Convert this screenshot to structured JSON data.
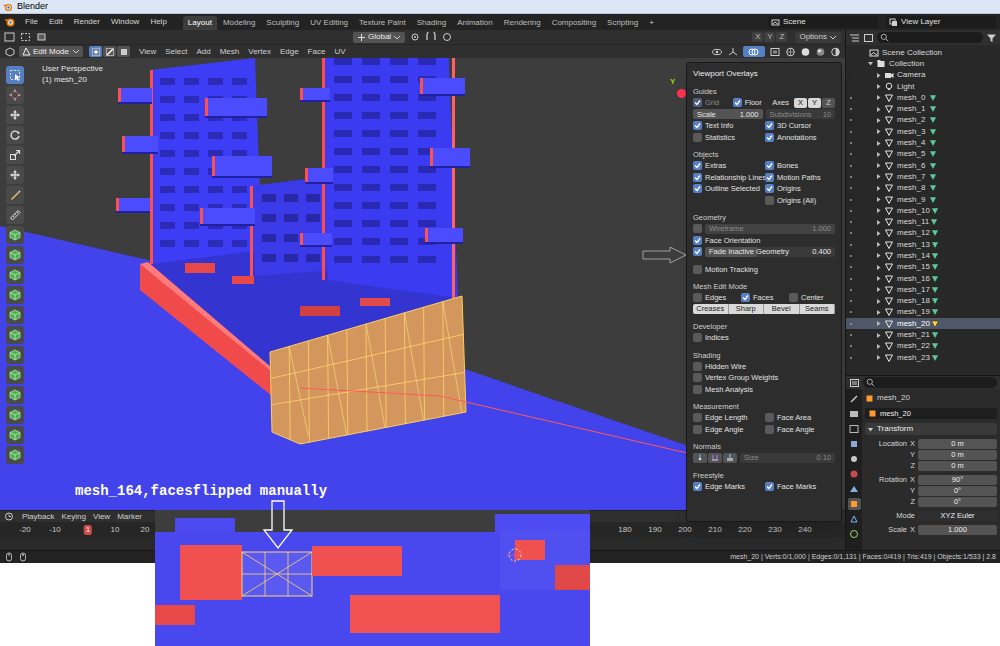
{
  "window": {
    "title": "Blender"
  },
  "topbar": {
    "menus": [
      "File",
      "Edit",
      "Render",
      "Window",
      "Help"
    ],
    "workspaces": [
      {
        "label": "Layout",
        "selected": true
      },
      {
        "label": "Modeling",
        "selected": false
      },
      {
        "label": "Sculpting",
        "selected": false
      },
      {
        "label": "UV Editing",
        "selected": false
      },
      {
        "label": "Texture Paint",
        "selected": false
      },
      {
        "label": "Shading",
        "selected": false
      },
      {
        "label": "Animation",
        "selected": false
      },
      {
        "label": "Rendering",
        "selected": false
      },
      {
        "label": "Compositing",
        "selected": false
      },
      {
        "label": "Scripting",
        "selected": false
      }
    ],
    "add_workspace": "+",
    "scene": "Scene",
    "view_layer": "View Layer"
  },
  "tool_settings": {
    "orientation": "Global",
    "mirror": [
      {
        "label": "X",
        "on": false
      },
      {
        "label": "Y",
        "on": false
      },
      {
        "label": "Z",
        "on": false
      }
    ],
    "options": "Options"
  },
  "viewport_header": {
    "mode": "Edit Mode",
    "select_modes": [
      {
        "selected": true
      },
      {
        "selected": false
      },
      {
        "selected": false
      }
    ],
    "menus": [
      "View",
      "Select",
      "Add",
      "Mesh",
      "Vertex",
      "Edge",
      "Face",
      "UV"
    ],
    "overlays_open": true
  },
  "viewport": {
    "view": "User Perspective",
    "object": "(1) mesh_20",
    "gizmo_axis": "Y"
  },
  "toolbar": {
    "tools": [
      {
        "selected": true
      },
      {
        "selected": false
      },
      {
        "selected": false
      },
      {
        "selected": false
      },
      {
        "selected": false
      },
      {
        "selected": false
      },
      {
        "selected": false
      },
      {
        "selected": false
      },
      {
        "selected": false
      },
      {
        "selected": false
      },
      {
        "selected": false
      },
      {
        "selected": false
      },
      {
        "selected": false
      },
      {
        "selected": false
      },
      {
        "selected": false
      },
      {
        "selected": false
      },
      {
        "selected": false
      },
      {
        "selected": false
      },
      {
        "selected": false
      },
      {
        "selected": false
      }
    ]
  },
  "overlays": {
    "title": "Viewport Overlays",
    "sections": [
      {
        "title": "Guides",
        "rows": [
          {
            "kind": "guides",
            "items": [
              {
                "label": "Grid",
                "checked": true,
                "disabled": true
              },
              {
                "label": "Floor",
                "checked": true,
                "disabled": false
              }
            ],
            "axes_label": "Axes",
            "axes": [
              {
                "label": "X",
                "on": true
              },
              {
                "label": "Y",
                "on": true
              },
              {
                "label": "Z",
                "on": false
              }
            ]
          },
          {
            "kind": "fields",
            "fields": [
              {
                "label": "Scale",
                "value": "1.000",
                "disabled": false
              },
              {
                "label": "Subdivisions",
                "value": "10",
                "disabled": true
              }
            ]
          },
          {
            "kind": "checks",
            "items": [
              {
                "label": "Text Info",
                "checked": true
              },
              {
                "label": "3D Cursor",
                "checked": true
              }
            ]
          },
          {
            "kind": "checks",
            "items": [
              {
                "label": "Statistics",
                "checked": false
              },
              {
                "label": "Annotations",
                "checked": true
              }
            ]
          }
        ]
      },
      {
        "title": "Objects",
        "rows": [
          {
            "kind": "checks",
            "items": [
              {
                "label": "Extras",
                "checked": true
              },
              {
                "label": "Bones",
                "checked": true
              }
            ]
          },
          {
            "kind": "checks",
            "items": [
              {
                "label": "Relationship Lines",
                "checked": true
              },
              {
                "label": "Motion Paths",
                "checked": true
              }
            ]
          },
          {
            "kind": "checks",
            "items": [
              {
                "label": "Outline Selected",
                "checked": true
              },
              {
                "label": "Origins",
                "checked": true
              }
            ]
          },
          {
            "kind": "check-right",
            "items": [
              {
                "label": "Origins (All)",
                "checked": false
              }
            ]
          }
        ]
      },
      {
        "title": "Geometry",
        "rows": [
          {
            "kind": "check-slider",
            "items": [
              {
                "label": "Wireframe",
                "checked": false
              }
            ],
            "value": "1.000",
            "level": 1,
            "disabled": true
          },
          {
            "kind": "checks",
            "items": [
              {
                "label": "Face Orientation",
                "checked": true
              }
            ]
          },
          {
            "kind": "check-slider",
            "items": [
              {
                "label": "Fade Inactive Geometry",
                "checked": true
              }
            ],
            "value": "0.400",
            "level": 0.4,
            "disabled": false
          }
        ]
      },
      {
        "rows": [
          {
            "kind": "checks",
            "items": [
              {
                "label": "Motion Tracking",
                "checked": false
              }
            ]
          }
        ]
      },
      {
        "title": "Mesh Edit Mode",
        "rows": [
          {
            "kind": "checks",
            "items": [
              {
                "label": "Edges",
                "checked": false
              },
              {
                "label": "Faces",
                "checked": true
              },
              {
                "label": "Center",
                "checked": false
              }
            ]
          },
          {
            "kind": "buttons",
            "items": [
              "Creases",
              "Sharp",
              "Bevel",
              "Seams"
            ]
          }
        ]
      },
      {
        "title": "Developer",
        "rows": [
          {
            "kind": "checks",
            "items": [
              {
                "label": "Indices",
                "checked": false
              }
            ]
          }
        ]
      },
      {
        "title": "Shading",
        "rows": [
          {
            "kind": "checks",
            "items": [
              {
                "label": "Hidden Wire",
                "checked": false
              }
            ]
          },
          {
            "kind": "checks",
            "items": [
              {
                "label": "Vertex Group Weights",
                "checked": false
              }
            ]
          },
          {
            "kind": "checks",
            "items": [
              {
                "label": "Mesh Analysis",
                "checked": false
              }
            ]
          }
        ]
      },
      {
        "title": "Measurement",
        "rows": [
          {
            "kind": "checks",
            "items": [
              {
                "label": "Edge Length",
                "checked": false
              },
              {
                "label": "Face Area",
                "checked": false
              }
            ]
          },
          {
            "kind": "checks",
            "items": [
              {
                "label": "Edge Angle",
                "checked": false
              },
              {
                "label": "Face Angle",
                "checked": false
              }
            ]
          }
        ]
      },
      {
        "title": "Normals",
        "rows": [
          {
            "kind": "normals",
            "size_label": "Size",
            "value": "0.10",
            "disabled": true
          }
        ]
      },
      {
        "title": "Freestyle",
        "rows": [
          {
            "kind": "checks",
            "items": [
              {
                "label": "Edge Marks",
                "checked": true
              },
              {
                "label": "Face Marks",
                "checked": true
              }
            ]
          }
        ]
      }
    ]
  },
  "outliner": {
    "rows": [
      {
        "label": "Scene Collection",
        "kind": "scene",
        "expanded": true,
        "selected": false
      },
      {
        "label": "Collection",
        "kind": "collection",
        "expanded": true,
        "selected": false
      },
      {
        "label": "Camera",
        "kind": "camera",
        "expanded": false,
        "selected": false
      },
      {
        "label": "Light",
        "kind": "light",
        "expanded": false,
        "selected": false
      },
      {
        "label": "mesh_0",
        "kind": "mesh",
        "expanded": false,
        "selected": false
      },
      {
        "label": "mesh_1",
        "kind": "mesh",
        "expanded": false,
        "selected": false
      },
      {
        "label": "mesh_2",
        "kind": "mesh",
        "expanded": false,
        "selected": false
      },
      {
        "label": "mesh_3",
        "kind": "mesh",
        "expanded": false,
        "selected": false
      },
      {
        "label": "mesh_4",
        "kind": "mesh",
        "expanded": false,
        "selected": false
      },
      {
        "label": "mesh_5",
        "kind": "mesh",
        "expanded": false,
        "selected": false
      },
      {
        "label": "mesh_6",
        "kind": "mesh",
        "expanded": false,
        "selected": false
      },
      {
        "label": "mesh_7",
        "kind": "mesh",
        "expanded": false,
        "selected": false
      },
      {
        "label": "mesh_8",
        "kind": "mesh",
        "expanded": false,
        "selected": false
      },
      {
        "label": "mesh_9",
        "kind": "mesh",
        "expanded": false,
        "selected": false
      },
      {
        "label": "mesh_10",
        "kind": "mesh",
        "expanded": false,
        "selected": false
      },
      {
        "label": "mesh_11",
        "kind": "mesh",
        "expanded": false,
        "selected": false
      },
      {
        "label": "mesh_12",
        "kind": "mesh",
        "expanded": false,
        "selected": false
      },
      {
        "label": "mesh_13",
        "kind": "mesh",
        "expanded": false,
        "selected": false
      },
      {
        "label": "mesh_14",
        "kind": "mesh",
        "expanded": false,
        "selected": false
      },
      {
        "label": "mesh_15",
        "kind": "mesh",
        "expanded": false,
        "selected": false
      },
      {
        "label": "mesh_16",
        "kind": "mesh",
        "expanded": false,
        "selected": false
      },
      {
        "label": "mesh_17",
        "kind": "mesh",
        "expanded": false,
        "selected": false
      },
      {
        "label": "mesh_18",
        "kind": "mesh",
        "expanded": false,
        "selected": false
      },
      {
        "label": "mesh_19",
        "kind": "mesh",
        "expanded": false,
        "selected": false
      },
      {
        "label": "mesh_20",
        "kind": "mesh",
        "expanded": false,
        "selected": true
      },
      {
        "label": "mesh_21",
        "kind": "mesh",
        "expanded": false,
        "selected": false
      },
      {
        "label": "mesh_22",
        "kind": "mesh",
        "expanded": false,
        "selected": false
      },
      {
        "label": "mesh_23",
        "kind": "mesh",
        "expanded": false,
        "selected": false
      }
    ]
  },
  "properties": {
    "object": "mesh_20",
    "name": "mesh_20",
    "panel": "Transform",
    "panel_expanded": true,
    "tabs": [
      {
        "selected": false
      },
      {
        "selected": false
      },
      {
        "selected": false
      },
      {
        "selected": false
      },
      {
        "selected": false
      },
      {
        "selected": false
      },
      {
        "selected": false
      },
      {
        "selected": true
      },
      {
        "selected": false
      },
      {
        "selected": false
      }
    ],
    "groups": [
      {
        "label": "Location",
        "rows": [
          {
            "axis": "X",
            "value": "0 m"
          },
          {
            "axis": "Y",
            "value": "0 m"
          },
          {
            "axis": "Z",
            "value": "0 m"
          }
        ]
      },
      {
        "label": "Rotation",
        "rows": [
          {
            "axis": "X",
            "value": "90°"
          },
          {
            "axis": "Y",
            "value": "0°"
          },
          {
            "axis": "Z",
            "value": "0°"
          }
        ]
      }
    ],
    "mode": {
      "label": "Mode",
      "value": "XYZ Euler"
    },
    "scale": {
      "label": "Scale",
      "axis": "X",
      "value": "1.000"
    }
  },
  "timeline": {
    "menus": [
      "Playback",
      "Keying",
      "View",
      "Marker"
    ],
    "frames": [
      {
        "label": "-20",
        "current": false
      },
      {
        "label": "-10",
        "current": false
      },
      {
        "label": "1",
        "current": true
      },
      {
        "label": "10",
        "current": false
      },
      {
        "label": "20",
        "current": false
      },
      {
        "label": "180",
        "current": false
      },
      {
        "label": "190",
        "current": false
      },
      {
        "label": "200",
        "current": false
      },
      {
        "label": "210",
        "current": false
      },
      {
        "label": "220",
        "current": false
      },
      {
        "label": "230",
        "current": false
      },
      {
        "label": "240",
        "current": false
      }
    ]
  },
  "status_bar": "mesh_20 | Verts:0/1,000 | Edges:0/1,131 | Faces:0/419 | Tris:419 | Objects:1/533 | 2.8",
  "annotations": {
    "caption": "mesh_164,facesflipped manually"
  }
}
